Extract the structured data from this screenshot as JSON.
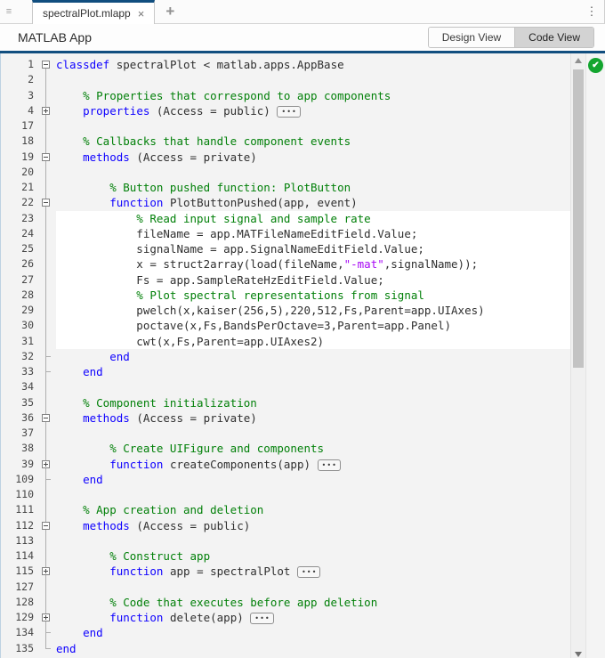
{
  "tab_bar": {
    "tab_title": "spectralPlot.mlapp",
    "close_label": "×",
    "new_tab_label": "+"
  },
  "icons": {
    "grip": "≡",
    "kebab": "⋮",
    "check": "✔",
    "ellipsis": "•••"
  },
  "toolbar": {
    "title": "MATLAB App",
    "design_view_label": "Design View",
    "code_view_label": "Code View",
    "active_view": "Code View"
  },
  "colors": {
    "accent_blue": "#114e7f",
    "keyword": "#0e00ff",
    "comment": "#028009",
    "string": "#a709f5",
    "code_text": "#2f2f2f",
    "editable_bg": "#ffffff",
    "readonly_bg": "#f3f3f3",
    "analyzer_green": "#13a52f"
  },
  "editor": {
    "analyzer_status": "ok",
    "lines": [
      {
        "n": "1",
        "fold": "open",
        "seg": [
          [
            "kw",
            "classdef"
          ],
          [
            "pl",
            " spectralPlot < matlab.apps.AppBase"
          ]
        ]
      },
      {
        "n": "2",
        "seg": []
      },
      {
        "n": "3",
        "seg": [
          [
            "cm",
            "    % Properties that correspond to app components"
          ]
        ]
      },
      {
        "n": "4",
        "fold": "closed",
        "ellipsis": true,
        "seg": [
          [
            "pl",
            "    "
          ],
          [
            "kw",
            "properties"
          ],
          [
            "pl",
            " (Access = public) "
          ]
        ]
      },
      {
        "n": "17",
        "seg": []
      },
      {
        "n": "18",
        "seg": [
          [
            "cm",
            "    % Callbacks that handle component events"
          ]
        ]
      },
      {
        "n": "19",
        "fold": "open",
        "seg": [
          [
            "pl",
            "    "
          ],
          [
            "kw",
            "methods"
          ],
          [
            "pl",
            " (Access = private)"
          ]
        ]
      },
      {
        "n": "20",
        "seg": []
      },
      {
        "n": "21",
        "seg": [
          [
            "cm",
            "        % Button pushed function: PlotButton"
          ]
        ]
      },
      {
        "n": "22",
        "fold": "open",
        "seg": [
          [
            "pl",
            "        "
          ],
          [
            "kw",
            "function"
          ],
          [
            "pl",
            " PlotButtonPushed(app, event)"
          ]
        ]
      },
      {
        "n": "23",
        "white": true,
        "seg": [
          [
            "cm",
            "            % Read input signal and sample rate"
          ]
        ]
      },
      {
        "n": "24",
        "white": true,
        "seg": [
          [
            "pl",
            "            fileName = app.MATFileNameEditField.Value;"
          ]
        ]
      },
      {
        "n": "25",
        "white": true,
        "seg": [
          [
            "pl",
            "            signalName = app.SignalNameEditField.Value;"
          ]
        ]
      },
      {
        "n": "26",
        "white": true,
        "seg": [
          [
            "pl",
            "            x = struct2array(load(fileName,"
          ],
          [
            "st",
            "\"-mat\""
          ],
          [
            "pl",
            ",signalName));"
          ]
        ]
      },
      {
        "n": "27",
        "white": true,
        "seg": [
          [
            "pl",
            "            Fs = app.SampleRateHzEditField.Value;"
          ]
        ]
      },
      {
        "n": "28",
        "white": true,
        "seg": [
          [
            "cm",
            "            % Plot spectral representations from signal"
          ]
        ]
      },
      {
        "n": "29",
        "white": true,
        "seg": [
          [
            "pl",
            "            pwelch(x,kaiser(256,5),220,512,Fs,Parent=app.UIAxes)"
          ]
        ]
      },
      {
        "n": "30",
        "white": true,
        "seg": [
          [
            "pl",
            "            poctave(x,Fs,BandsPerOctave=3,Parent=app.Panel)"
          ]
        ]
      },
      {
        "n": "31",
        "white": true,
        "seg": [
          [
            "pl",
            "            cwt(x,Fs,Parent=app.UIAxes2)"
          ]
        ]
      },
      {
        "n": "32",
        "fold": "end",
        "seg": [
          [
            "pl",
            "        "
          ],
          [
            "kw",
            "end"
          ]
        ]
      },
      {
        "n": "33",
        "fold": "end",
        "seg": [
          [
            "pl",
            "    "
          ],
          [
            "kw",
            "end"
          ]
        ]
      },
      {
        "n": "34",
        "seg": []
      },
      {
        "n": "35",
        "seg": [
          [
            "cm",
            "    % Component initialization"
          ]
        ]
      },
      {
        "n": "36",
        "fold": "open",
        "seg": [
          [
            "pl",
            "    "
          ],
          [
            "kw",
            "methods"
          ],
          [
            "pl",
            " (Access = private)"
          ]
        ]
      },
      {
        "n": "37",
        "seg": []
      },
      {
        "n": "38",
        "seg": [
          [
            "cm",
            "        % Create UIFigure and components"
          ]
        ]
      },
      {
        "n": "39",
        "fold": "closed",
        "ellipsis": true,
        "seg": [
          [
            "pl",
            "        "
          ],
          [
            "kw",
            "function"
          ],
          [
            "pl",
            " createComponents(app) "
          ]
        ]
      },
      {
        "n": "109",
        "fold": "end",
        "seg": [
          [
            "pl",
            "    "
          ],
          [
            "kw",
            "end"
          ]
        ]
      },
      {
        "n": "110",
        "seg": []
      },
      {
        "n": "111",
        "seg": [
          [
            "cm",
            "    % App creation and deletion"
          ]
        ]
      },
      {
        "n": "112",
        "fold": "open",
        "seg": [
          [
            "pl",
            "    "
          ],
          [
            "kw",
            "methods"
          ],
          [
            "pl",
            " (Access = public)"
          ]
        ]
      },
      {
        "n": "113",
        "seg": []
      },
      {
        "n": "114",
        "seg": [
          [
            "cm",
            "        % Construct app"
          ]
        ]
      },
      {
        "n": "115",
        "fold": "closed",
        "ellipsis": true,
        "seg": [
          [
            "pl",
            "        "
          ],
          [
            "kw",
            "function"
          ],
          [
            "pl",
            " app = spectralPlot "
          ]
        ]
      },
      {
        "n": "127",
        "seg": []
      },
      {
        "n": "128",
        "seg": [
          [
            "cm",
            "        % Code that executes before app deletion"
          ]
        ]
      },
      {
        "n": "129",
        "fold": "closed",
        "ellipsis": true,
        "seg": [
          [
            "pl",
            "        "
          ],
          [
            "kw",
            "function"
          ],
          [
            "pl",
            " delete(app) "
          ]
        ]
      },
      {
        "n": "134",
        "fold": "end",
        "seg": [
          [
            "pl",
            "    "
          ],
          [
            "kw",
            "end"
          ]
        ]
      },
      {
        "n": "135",
        "fold": "end",
        "seg": [
          [
            "kw",
            "end"
          ]
        ]
      }
    ]
  }
}
